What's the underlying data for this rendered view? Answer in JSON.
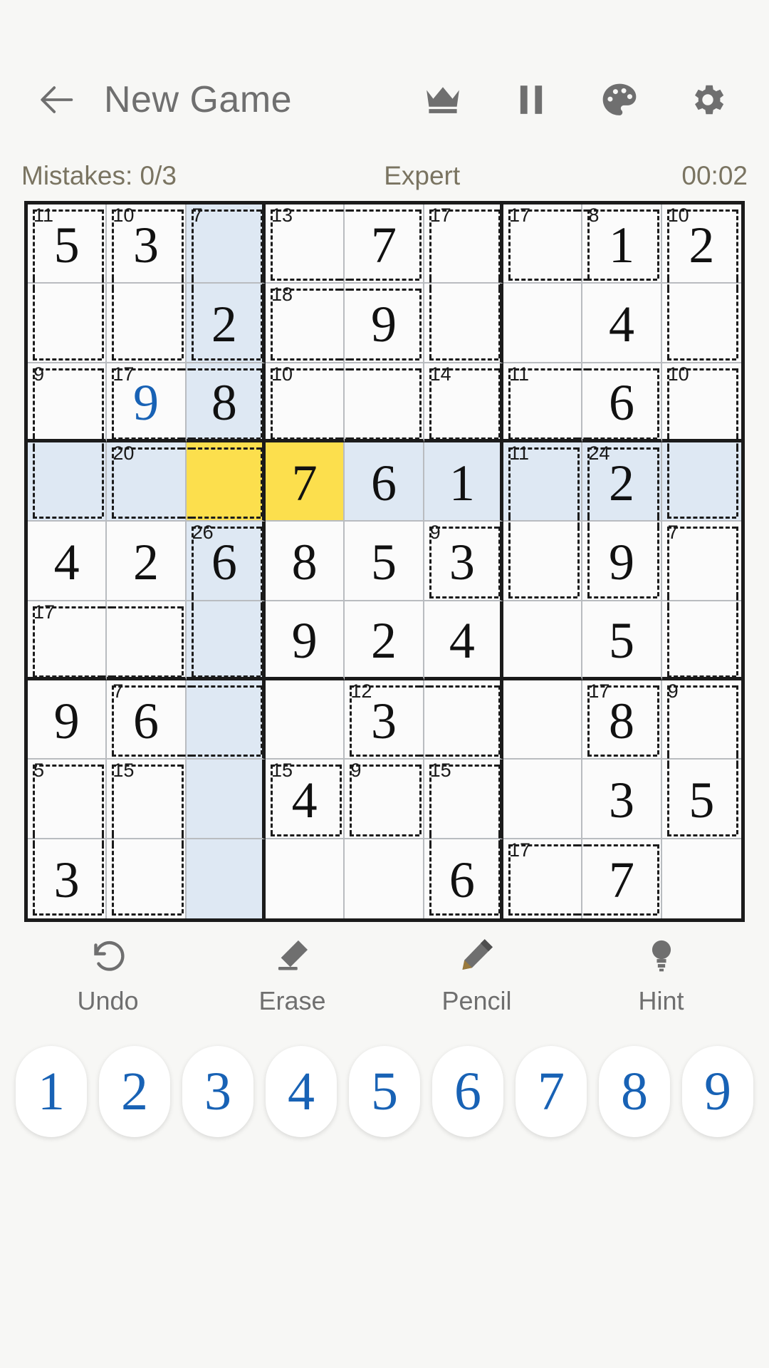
{
  "header": {
    "back_icon": "back-arrow-icon",
    "title": "New Game",
    "icons": [
      {
        "name": "crown-icon",
        "label": "crown"
      },
      {
        "name": "pause-icon",
        "label": "pause"
      },
      {
        "name": "palette-icon",
        "label": "palette"
      },
      {
        "name": "gear-icon",
        "label": "settings"
      }
    ]
  },
  "status": {
    "mistakes": "Mistakes: 0/3",
    "difficulty": "Expert",
    "timer": "00:02"
  },
  "colors": {
    "accent_blue": "#1862b5",
    "selected_yellow": "#fcdf4d",
    "highlight_blue": "#dee8f3",
    "grid_dark": "#1b1b1b",
    "status_text": "#7a7461",
    "title_text": "#6f6f6f"
  },
  "board": {
    "size": 9,
    "selected_cell": {
      "row": 3,
      "col": 2
    },
    "highlight_row": 3,
    "highlight_col": 2,
    "cells": [
      [
        {
          "v": "5",
          "t": "given"
        },
        {
          "v": "3",
          "t": "given"
        },
        {
          "v": "",
          "t": ""
        },
        {
          "v": "",
          "t": ""
        },
        {
          "v": "7",
          "t": "given"
        },
        {
          "v": "",
          "t": ""
        },
        {
          "v": "",
          "t": ""
        },
        {
          "v": "1",
          "t": "given"
        },
        {
          "v": "2",
          "t": "given"
        }
      ],
      [
        {
          "v": "",
          "t": ""
        },
        {
          "v": "",
          "t": ""
        },
        {
          "v": "2",
          "t": "given"
        },
        {
          "v": "",
          "t": ""
        },
        {
          "v": "9",
          "t": "given"
        },
        {
          "v": "",
          "t": ""
        },
        {
          "v": "",
          "t": ""
        },
        {
          "v": "4",
          "t": "given"
        },
        {
          "v": "",
          "t": ""
        }
      ],
      [
        {
          "v": "",
          "t": ""
        },
        {
          "v": "9",
          "t": "user"
        },
        {
          "v": "8",
          "t": "given"
        },
        {
          "v": "",
          "t": ""
        },
        {
          "v": "",
          "t": ""
        },
        {
          "v": "",
          "t": ""
        },
        {
          "v": "",
          "t": ""
        },
        {
          "v": "6",
          "t": "given"
        },
        {
          "v": "",
          "t": ""
        }
      ],
      [
        {
          "v": "",
          "t": ""
        },
        {
          "v": "",
          "t": ""
        },
        {
          "v": "",
          "t": ""
        },
        {
          "v": "7",
          "t": "given"
        },
        {
          "v": "6",
          "t": "given"
        },
        {
          "v": "1",
          "t": "given"
        },
        {
          "v": "",
          "t": ""
        },
        {
          "v": "2",
          "t": "given"
        },
        {
          "v": "",
          "t": ""
        }
      ],
      [
        {
          "v": "4",
          "t": "given"
        },
        {
          "v": "2",
          "t": "given"
        },
        {
          "v": "6",
          "t": "given"
        },
        {
          "v": "8",
          "t": "given"
        },
        {
          "v": "5",
          "t": "given"
        },
        {
          "v": "3",
          "t": "given"
        },
        {
          "v": "",
          "t": ""
        },
        {
          "v": "9",
          "t": "given"
        },
        {
          "v": "",
          "t": ""
        }
      ],
      [
        {
          "v": "",
          "t": ""
        },
        {
          "v": "",
          "t": ""
        },
        {
          "v": "",
          "t": ""
        },
        {
          "v": "9",
          "t": "given"
        },
        {
          "v": "2",
          "t": "given"
        },
        {
          "v": "4",
          "t": "given"
        },
        {
          "v": "",
          "t": ""
        },
        {
          "v": "5",
          "t": "given"
        },
        {
          "v": "",
          "t": ""
        }
      ],
      [
        {
          "v": "9",
          "t": "given"
        },
        {
          "v": "6",
          "t": "given"
        },
        {
          "v": "",
          "t": ""
        },
        {
          "v": "",
          "t": ""
        },
        {
          "v": "3",
          "t": "given"
        },
        {
          "v": "",
          "t": ""
        },
        {
          "v": "",
          "t": ""
        },
        {
          "v": "8",
          "t": "given"
        },
        {
          "v": "",
          "t": ""
        }
      ],
      [
        {
          "v": "",
          "t": ""
        },
        {
          "v": "",
          "t": ""
        },
        {
          "v": "",
          "t": ""
        },
        {
          "v": "4",
          "t": "given"
        },
        {
          "v": "",
          "t": ""
        },
        {
          "v": "",
          "t": ""
        },
        {
          "v": "",
          "t": ""
        },
        {
          "v": "3",
          "t": "given"
        },
        {
          "v": "5",
          "t": "given"
        }
      ],
      [
        {
          "v": "3",
          "t": "given"
        },
        {
          "v": "",
          "t": ""
        },
        {
          "v": "",
          "t": ""
        },
        {
          "v": "",
          "t": ""
        },
        {
          "v": "",
          "t": ""
        },
        {
          "v": "6",
          "t": "given"
        },
        {
          "v": "",
          "t": ""
        },
        {
          "v": "7",
          "t": "given"
        },
        {
          "v": "",
          "t": ""
        }
      ]
    ],
    "cages": [
      {
        "sum": 11,
        "cells": [
          [
            0,
            0
          ],
          [
            1,
            0
          ]
        ]
      },
      {
        "sum": 10,
        "cells": [
          [
            0,
            1
          ],
          [
            1,
            1
          ]
        ]
      },
      {
        "sum": 7,
        "cells": [
          [
            0,
            2
          ],
          [
            1,
            2
          ]
        ]
      },
      {
        "sum": 13,
        "cells": [
          [
            0,
            3
          ],
          [
            0,
            4
          ]
        ]
      },
      {
        "sum": 17,
        "cells": [
          [
            0,
            5
          ],
          [
            1,
            5
          ]
        ]
      },
      {
        "sum": 18,
        "cells": [
          [
            1,
            3
          ],
          [
            1,
            4
          ]
        ]
      },
      {
        "sum": 17,
        "cells": [
          [
            0,
            6
          ],
          [
            0,
            7
          ]
        ]
      },
      {
        "sum": 8,
        "cells": [
          [
            0,
            7
          ]
        ]
      },
      {
        "sum": 10,
        "cells": [
          [
            0,
            8
          ],
          [
            1,
            8
          ]
        ]
      },
      {
        "sum": 9,
        "cells": [
          [
            2,
            0
          ],
          [
            3,
            0
          ]
        ]
      },
      {
        "sum": 17,
        "cells": [
          [
            2,
            1
          ],
          [
            2,
            2
          ]
        ]
      },
      {
        "sum": 10,
        "cells": [
          [
            2,
            3
          ],
          [
            2,
            4
          ]
        ]
      },
      {
        "sum": 14,
        "cells": [
          [
            2,
            5
          ]
        ]
      },
      {
        "sum": 11,
        "cells": [
          [
            2,
            6
          ],
          [
            2,
            7
          ]
        ]
      },
      {
        "sum": 10,
        "cells": [
          [
            2,
            8
          ],
          [
            3,
            8
          ]
        ]
      },
      {
        "sum": 20,
        "cells": [
          [
            3,
            1
          ],
          [
            3,
            2
          ]
        ]
      },
      {
        "sum": 11,
        "cells": [
          [
            3,
            6
          ],
          [
            4,
            6
          ]
        ]
      },
      {
        "sum": 24,
        "cells": [
          [
            3,
            7
          ],
          [
            4,
            7
          ]
        ]
      },
      {
        "sum": 26,
        "cells": [
          [
            4,
            2
          ],
          [
            5,
            2
          ]
        ]
      },
      {
        "sum": 9,
        "cells": [
          [
            4,
            5
          ]
        ]
      },
      {
        "sum": 7,
        "cells": [
          [
            4,
            8
          ],
          [
            5,
            8
          ]
        ]
      },
      {
        "sum": 17,
        "cells": [
          [
            5,
            0
          ],
          [
            5,
            1
          ]
        ]
      },
      {
        "sum": 7,
        "cells": [
          [
            6,
            1
          ],
          [
            6,
            2
          ]
        ]
      },
      {
        "sum": 12,
        "cells": [
          [
            6,
            4
          ],
          [
            6,
            5
          ]
        ]
      },
      {
        "sum": 17,
        "cells": [
          [
            6,
            7
          ]
        ]
      },
      {
        "sum": 9,
        "cells": [
          [
            6,
            8
          ],
          [
            7,
            8
          ]
        ]
      },
      {
        "sum": 5,
        "cells": [
          [
            7,
            0
          ],
          [
            8,
            0
          ]
        ]
      },
      {
        "sum": 15,
        "cells": [
          [
            7,
            1
          ],
          [
            8,
            1
          ]
        ]
      },
      {
        "sum": 15,
        "cells": [
          [
            7,
            3
          ]
        ]
      },
      {
        "sum": 9,
        "cells": [
          [
            7,
            4
          ]
        ]
      },
      {
        "sum": 15,
        "cells": [
          [
            7,
            5
          ],
          [
            8,
            5
          ]
        ]
      },
      {
        "sum": 17,
        "cells": [
          [
            8,
            6
          ],
          [
            8,
            7
          ]
        ]
      }
    ]
  },
  "tools": [
    {
      "name": "undo-button",
      "icon": "undo-icon",
      "label": "Undo"
    },
    {
      "name": "erase-button",
      "icon": "eraser-icon",
      "label": "Erase"
    },
    {
      "name": "pencil-button",
      "icon": "pencil-icon",
      "label": "Pencil"
    },
    {
      "name": "hint-button",
      "icon": "bulb-icon",
      "label": "Hint"
    }
  ],
  "numpad": [
    "1",
    "2",
    "3",
    "4",
    "5",
    "6",
    "7",
    "8",
    "9"
  ]
}
